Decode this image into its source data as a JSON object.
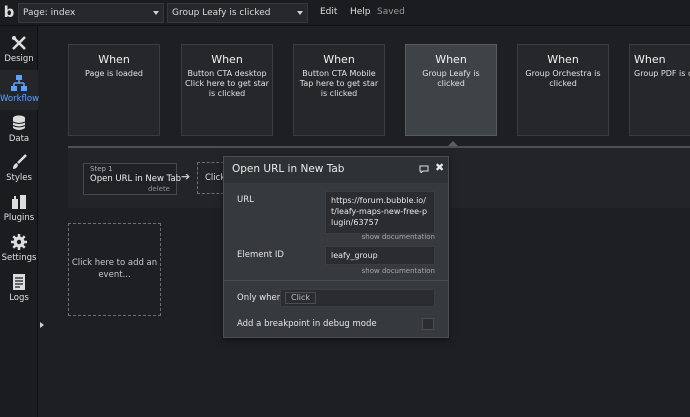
{
  "topbar": {
    "logo": "b",
    "page_select": "Page: index",
    "workflow_select": "Group Leafy is clicked",
    "edit": "Edit",
    "help": "Help",
    "saved": "Saved"
  },
  "sidebar": {
    "items": [
      {
        "label": "Design",
        "icon": "design-icon"
      },
      {
        "label": "Workflow",
        "icon": "workflow-icon",
        "active": true
      },
      {
        "label": "Data",
        "icon": "database-icon"
      },
      {
        "label": "Styles",
        "icon": "brush-icon"
      },
      {
        "label": "Plugins",
        "icon": "plugin-icon"
      },
      {
        "label": "Settings",
        "icon": "gear-icon"
      },
      {
        "label": "Logs",
        "icon": "log-icon"
      }
    ]
  },
  "events": [
    {
      "when": "When",
      "desc": "Page is loaded"
    },
    {
      "when": "When",
      "desc": "Button CTA desktop Click here to get star is clicked"
    },
    {
      "when": "When",
      "desc": "Button CTA Mobile Tap here to get star is clicked"
    },
    {
      "when": "When",
      "desc": "Group Leafy is clicked",
      "selected": true
    },
    {
      "when": "When",
      "desc": "Group Orchestra is clicked"
    },
    {
      "when": "When",
      "desc": "Group PDF is c"
    }
  ],
  "actions": {
    "step_num": "Step 1",
    "step_name": "Open URL in New Tab",
    "delete": "delete",
    "add_step": "Click"
  },
  "add_event": "Click here to add an event...",
  "panel": {
    "title": "Open URL in New Tab",
    "url_label": "URL",
    "url_value": "https://forum.bubble.io/t/leafy-maps-new-free-plugin/63757",
    "show_doc": "show documentation",
    "element_label": "Element ID",
    "element_value": "leafy_group",
    "only_when_label": "Only when",
    "only_when_chip": "Click",
    "breakpoint_label": "Add a breakpoint in debug mode"
  },
  "colors": {
    "accent": "#5aa2ff",
    "selected_card": "#3e4347"
  }
}
